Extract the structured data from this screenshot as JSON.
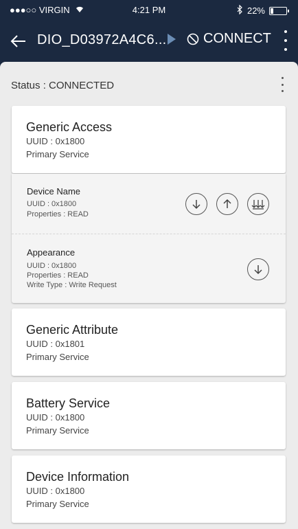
{
  "statusbar": {
    "carrier": "●●●○○ VIRGIN",
    "time": "4:21 PM",
    "battery": "22%",
    "battery_level": 0.22
  },
  "appbar": {
    "back_icon": "arrow-left-icon",
    "device_name": "DIO_D03972A4C6...",
    "connect_label": "CONNECT",
    "colors": {
      "background": "#1b2940",
      "play": "#6b8db5"
    }
  },
  "status": {
    "text": "Status : CONNECTED"
  },
  "services": [
    {
      "name": "Generic Access",
      "uuid": "UUID : 0x1800",
      "type": "Primary Service",
      "characteristics": [
        {
          "name": "Device Name",
          "uuid": "UUID : 0x1800",
          "properties": "Properties : READ",
          "actions": [
            "read-icon",
            "write-icon",
            "notify-icon"
          ]
        },
        {
          "name": "Appearance",
          "uuid": "UUID : 0x1800",
          "properties": "Properties : READ",
          "write_type": "Write Type : Write Request",
          "actions": [
            "read-icon"
          ]
        }
      ]
    },
    {
      "name": "Generic Attribute",
      "uuid": "UUID : 0x1801",
      "type": "Primary Service"
    },
    {
      "name": "Battery Service",
      "uuid": "UUID : 0x1800",
      "type": "Primary Service"
    },
    {
      "name": "Device Information",
      "uuid": "UUID : 0x1800",
      "type": "Primary Service"
    }
  ]
}
